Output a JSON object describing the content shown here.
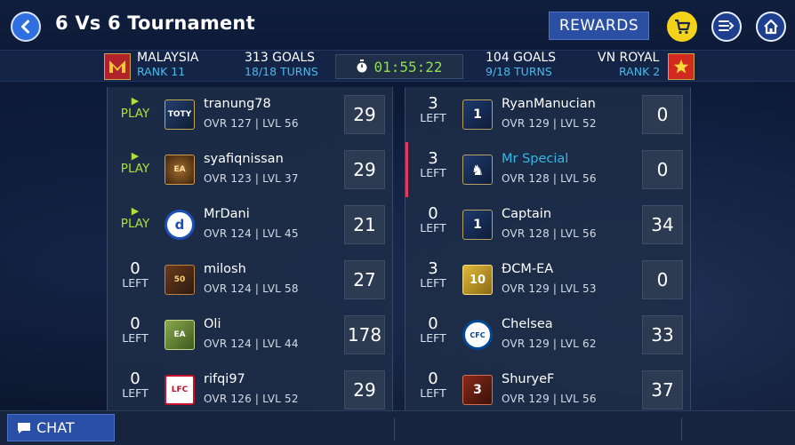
{
  "header": {
    "title": "6 Vs 6 Tournament",
    "rewards_label": "REWARDS",
    "icons": {
      "back": "back-arrow-icon",
      "cart": "cart-icon",
      "menu": "menu-list-icon",
      "home": "home-icon"
    }
  },
  "scoreboard": {
    "left_team": {
      "name": "MALAYSIA",
      "rank": "RANK 11",
      "goals": "313 GOALS",
      "turns": "18/18 TURNS"
    },
    "timer": "01:55:22",
    "right_team": {
      "name": "VN ROYAL",
      "rank": "RANK 2",
      "goals": "104 GOALS",
      "turns": "9/18 TURNS"
    }
  },
  "left_players": [
    {
      "status_top": "▶",
      "status_label": "PLAY",
      "name": "tranung78",
      "stats": "OVR 127 | LVL 56",
      "goals": "29",
      "badge": "TOTY"
    },
    {
      "status_top": "▶",
      "status_label": "PLAY",
      "name": "syafiqnissan",
      "stats": "OVR 123 | LVL 37",
      "goals": "29",
      "badge": "EA"
    },
    {
      "status_top": "▶",
      "status_label": "PLAY",
      "name": "MrDani",
      "stats": "OVR 124 | LVL 45",
      "goals": "21",
      "badge": "d"
    },
    {
      "status_top": "0",
      "status_label": "LEFT",
      "name": "milosh",
      "stats": "OVR 124 | LVL 58",
      "goals": "27",
      "badge": "50"
    },
    {
      "status_top": "0",
      "status_label": "LEFT",
      "name": "Oli",
      "stats": "OVR 124 | LVL 44",
      "goals": "178",
      "badge": "EA"
    },
    {
      "status_top": "0",
      "status_label": "LEFT",
      "name": "rifqi97",
      "stats": "OVR 126 | LVL 52",
      "goals": "29",
      "badge": "LFC"
    }
  ],
  "right_players": [
    {
      "status_top": "3",
      "status_label": "LEFT",
      "name": "RyanManucian",
      "stats": "OVR 129 | LVL 52",
      "goals": "0",
      "badge": "1"
    },
    {
      "status_top": "3",
      "status_label": "LEFT",
      "name": "Mr Special",
      "stats": "OVR 128 | LVL 56",
      "goals": "0",
      "badge": "♞"
    },
    {
      "status_top": "0",
      "status_label": "LEFT",
      "name": "Captain",
      "stats": "OVR 128 | LVL 56",
      "goals": "34",
      "badge": "1"
    },
    {
      "status_top": "3",
      "status_label": "LEFT",
      "name": "ĐCM-EA",
      "stats": "OVR 129 | LVL 53",
      "goals": "0",
      "badge": "10"
    },
    {
      "status_top": "0",
      "status_label": "LEFT",
      "name": "Chelsea",
      "stats": "OVR 129 | LVL 62",
      "goals": "33",
      "badge": "CFC"
    },
    {
      "status_top": "0",
      "status_label": "LEFT",
      "name": "ShuryeF",
      "stats": "OVR 129 | LVL 56",
      "goals": "37",
      "badge": "3"
    }
  ],
  "chat": {
    "label": "CHAT"
  },
  "colors": {
    "accent": "#2b4fa3",
    "play": "#a9e23a",
    "highlight": "#36b6e6",
    "timer": "#8ee04a",
    "active_marker": "#e5395e"
  }
}
